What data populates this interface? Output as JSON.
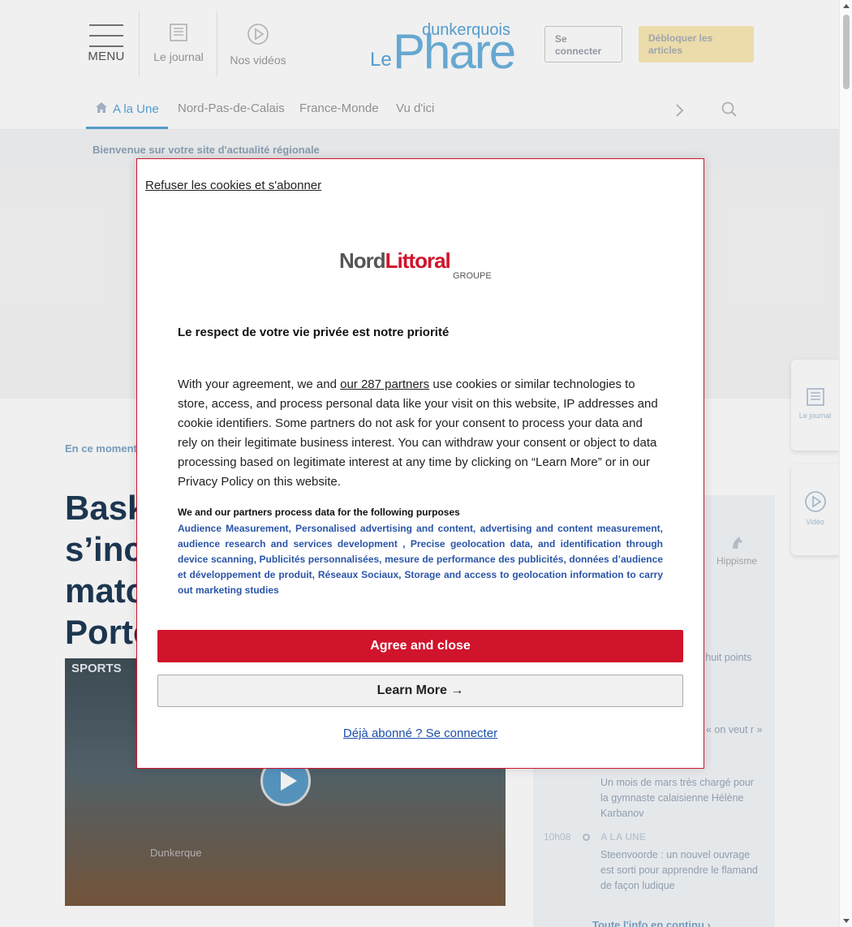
{
  "header": {
    "menu_label": "MENU",
    "journal_label": "Le journal",
    "videos_label": "Nos vidéos",
    "logo": {
      "le": "Le",
      "name": "Phare",
      "city": "dunkerquois"
    },
    "login_label": "Se connecter",
    "unlock_label": "Débloquer les articles"
  },
  "nav": {
    "tabs": [
      "A la Une",
      "Nord-Pas-de-Calais",
      "France-Monde",
      "Vu d'ici"
    ]
  },
  "welcome": "Bienvenue sur votre site d'actualité régionale",
  "article": {
    "moment_label": "En ce moment",
    "headline_visible": "Baske s’incl match Porte",
    "video_overlay": {
      "sports": "SPORTS",
      "dunkerque": "Dunkerque"
    }
  },
  "sidebar": {
    "hippisme_label": "Hippisme",
    "news": [
      {
        "time": "",
        "category": "",
        "text": "ECM huit points"
      },
      {
        "time": "",
        "category": "",
        "text": "« on veut r »"
      },
      {
        "time": "",
        "category": "",
        "text": "Un mois de mars très chargé pour la gymnaste calaisienne Hélène Karbanov"
      },
      {
        "time": "10h08",
        "category": "A LA UNE",
        "text": "Steenvoorde : un nouvel ouvrage est sorti pour apprendre le flamand de façon ludique"
      }
    ],
    "all_news": "Toute l'info en continu ›"
  },
  "float_buttons": {
    "journal": "Le journal",
    "video": "Vidéo"
  },
  "consent": {
    "refuse_link": "Refuser les cookies et s'abonner",
    "brand": {
      "nord": "Nord",
      "littoral": "Littoral",
      "groupe": "GROUPE"
    },
    "title": "Le respect de votre vie privée est notre priorité",
    "body_before": "With your agreement, we and ",
    "partners_link": "our 287 partners",
    "body_after": " use cookies or similar technologies to store, access, and process personal data like your visit on this website, IP addresses and cookie identifiers. Some partners do not ask for your consent to process your data and rely on their legitimate business interest. You can withdraw your consent or object to data processing based on legitimate interest at any time by clicking on “Learn More” or in our Privacy Policy on this website.",
    "purposes_title": "We and our partners process data for the following purposes",
    "purposes": "Audience Measurement, Personalised advertising and content, advertising and content measurement, audience research and services development , Precise geolocation data, and identification through device scanning, Publicités personnalisées, mesure de performance des publicités, données d’audience et développement de produit, Réseaux Sociaux, Storage and access to geolocation information to carry out marketing studies",
    "agree_label": "Agree and close",
    "learn_label": "Learn More →",
    "already_label": "Déjà abonné ? Se connecter"
  }
}
